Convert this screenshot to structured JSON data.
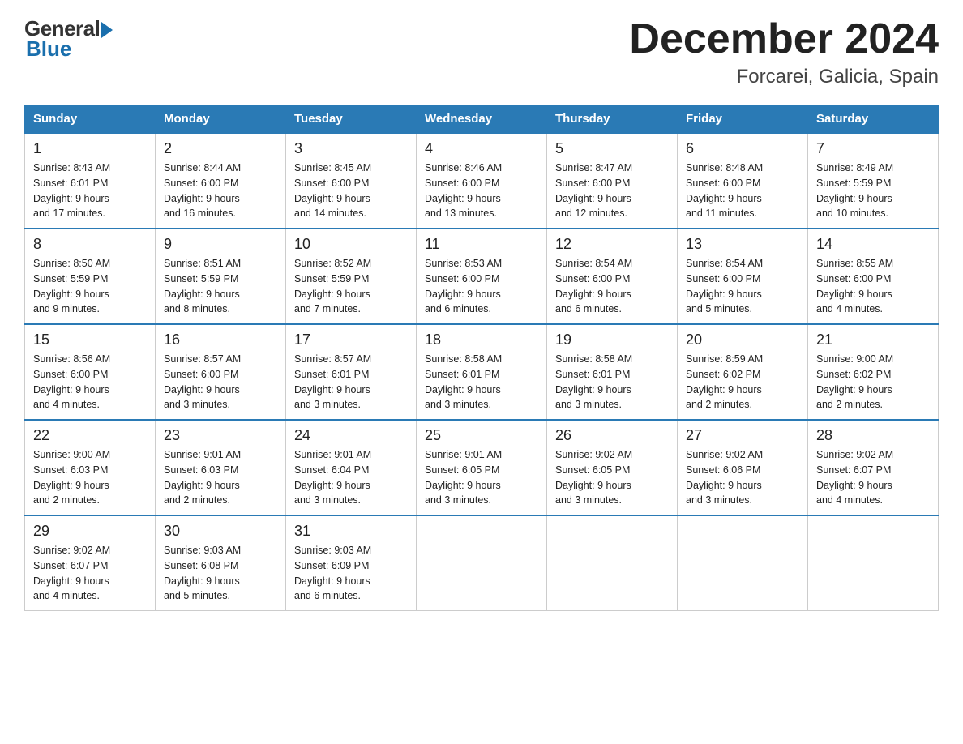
{
  "logo": {
    "general": "General",
    "blue": "Blue"
  },
  "title": "December 2024",
  "subtitle": "Forcarei, Galicia, Spain",
  "days_of_week": [
    "Sunday",
    "Monday",
    "Tuesday",
    "Wednesday",
    "Thursday",
    "Friday",
    "Saturday"
  ],
  "weeks": [
    [
      {
        "day": "1",
        "sunrise": "8:43 AM",
        "sunset": "6:01 PM",
        "daylight": "9 hours and 17 minutes."
      },
      {
        "day": "2",
        "sunrise": "8:44 AM",
        "sunset": "6:00 PM",
        "daylight": "9 hours and 16 minutes."
      },
      {
        "day": "3",
        "sunrise": "8:45 AM",
        "sunset": "6:00 PM",
        "daylight": "9 hours and 14 minutes."
      },
      {
        "day": "4",
        "sunrise": "8:46 AM",
        "sunset": "6:00 PM",
        "daylight": "9 hours and 13 minutes."
      },
      {
        "day": "5",
        "sunrise": "8:47 AM",
        "sunset": "6:00 PM",
        "daylight": "9 hours and 12 minutes."
      },
      {
        "day": "6",
        "sunrise": "8:48 AM",
        "sunset": "6:00 PM",
        "daylight": "9 hours and 11 minutes."
      },
      {
        "day": "7",
        "sunrise": "8:49 AM",
        "sunset": "5:59 PM",
        "daylight": "9 hours and 10 minutes."
      }
    ],
    [
      {
        "day": "8",
        "sunrise": "8:50 AM",
        "sunset": "5:59 PM",
        "daylight": "9 hours and 9 minutes."
      },
      {
        "day": "9",
        "sunrise": "8:51 AM",
        "sunset": "5:59 PM",
        "daylight": "9 hours and 8 minutes."
      },
      {
        "day": "10",
        "sunrise": "8:52 AM",
        "sunset": "5:59 PM",
        "daylight": "9 hours and 7 minutes."
      },
      {
        "day": "11",
        "sunrise": "8:53 AM",
        "sunset": "6:00 PM",
        "daylight": "9 hours and 6 minutes."
      },
      {
        "day": "12",
        "sunrise": "8:54 AM",
        "sunset": "6:00 PM",
        "daylight": "9 hours and 6 minutes."
      },
      {
        "day": "13",
        "sunrise": "8:54 AM",
        "sunset": "6:00 PM",
        "daylight": "9 hours and 5 minutes."
      },
      {
        "day": "14",
        "sunrise": "8:55 AM",
        "sunset": "6:00 PM",
        "daylight": "9 hours and 4 minutes."
      }
    ],
    [
      {
        "day": "15",
        "sunrise": "8:56 AM",
        "sunset": "6:00 PM",
        "daylight": "9 hours and 4 minutes."
      },
      {
        "day": "16",
        "sunrise": "8:57 AM",
        "sunset": "6:00 PM",
        "daylight": "9 hours and 3 minutes."
      },
      {
        "day": "17",
        "sunrise": "8:57 AM",
        "sunset": "6:01 PM",
        "daylight": "9 hours and 3 minutes."
      },
      {
        "day": "18",
        "sunrise": "8:58 AM",
        "sunset": "6:01 PM",
        "daylight": "9 hours and 3 minutes."
      },
      {
        "day": "19",
        "sunrise": "8:58 AM",
        "sunset": "6:01 PM",
        "daylight": "9 hours and 3 minutes."
      },
      {
        "day": "20",
        "sunrise": "8:59 AM",
        "sunset": "6:02 PM",
        "daylight": "9 hours and 2 minutes."
      },
      {
        "day": "21",
        "sunrise": "9:00 AM",
        "sunset": "6:02 PM",
        "daylight": "9 hours and 2 minutes."
      }
    ],
    [
      {
        "day": "22",
        "sunrise": "9:00 AM",
        "sunset": "6:03 PM",
        "daylight": "9 hours and 2 minutes."
      },
      {
        "day": "23",
        "sunrise": "9:01 AM",
        "sunset": "6:03 PM",
        "daylight": "9 hours and 2 minutes."
      },
      {
        "day": "24",
        "sunrise": "9:01 AM",
        "sunset": "6:04 PM",
        "daylight": "9 hours and 3 minutes."
      },
      {
        "day": "25",
        "sunrise": "9:01 AM",
        "sunset": "6:05 PM",
        "daylight": "9 hours and 3 minutes."
      },
      {
        "day": "26",
        "sunrise": "9:02 AM",
        "sunset": "6:05 PM",
        "daylight": "9 hours and 3 minutes."
      },
      {
        "day": "27",
        "sunrise": "9:02 AM",
        "sunset": "6:06 PM",
        "daylight": "9 hours and 3 minutes."
      },
      {
        "day": "28",
        "sunrise": "9:02 AM",
        "sunset": "6:07 PM",
        "daylight": "9 hours and 4 minutes."
      }
    ],
    [
      {
        "day": "29",
        "sunrise": "9:02 AM",
        "sunset": "6:07 PM",
        "daylight": "9 hours and 4 minutes."
      },
      {
        "day": "30",
        "sunrise": "9:03 AM",
        "sunset": "6:08 PM",
        "daylight": "9 hours and 5 minutes."
      },
      {
        "day": "31",
        "sunrise": "9:03 AM",
        "sunset": "6:09 PM",
        "daylight": "9 hours and 6 minutes."
      },
      null,
      null,
      null,
      null
    ]
  ],
  "labels": {
    "sunrise": "Sunrise:",
    "sunset": "Sunset:",
    "daylight": "Daylight:"
  }
}
